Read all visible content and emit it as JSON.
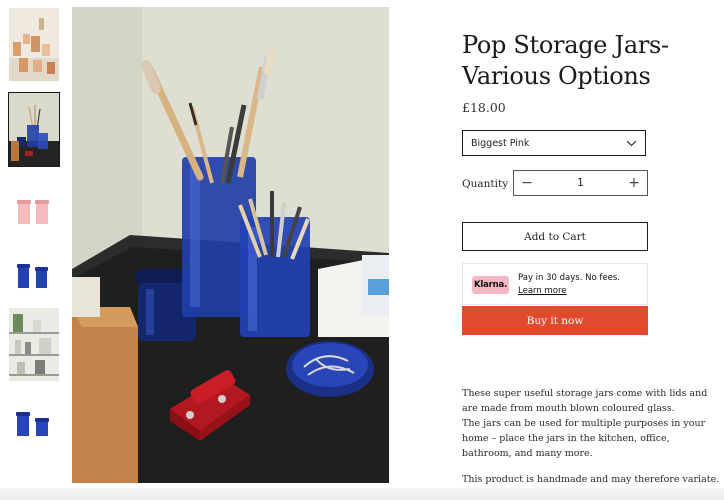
{
  "product": {
    "title_line1": "Pop Storage Jars-",
    "title_line2": "Various Options",
    "price": "£18.00"
  },
  "variant_select": {
    "selected": "Biggest Pink"
  },
  "quantity": {
    "label": "Quantity",
    "value": "1",
    "decrement": "−",
    "increment": "+"
  },
  "buttons": {
    "add_to_cart": "Add to Cart",
    "buy_now": "Buy it now"
  },
  "klarna": {
    "badge": "Klarna.",
    "message": "Pay in 30 days. No fees.",
    "link": "Learn more"
  },
  "description": {
    "p1": "These super useful storage jars come with lids and are made from mouth blown coloured glass.",
    "p2": "The jars can be used for multiple purposes in your home – place the jars in the kitchen, office, bathroom, and many more.",
    "p3": "This product is handmade and may therefore variate."
  },
  "thumbnails": [
    {
      "name": "thumbnail-amber-jars",
      "active": false
    },
    {
      "name": "thumbnail-blue-brush-jars",
      "active": true
    },
    {
      "name": "thumbnail-pink-jars",
      "active": false
    },
    {
      "name": "thumbnail-blue-jars",
      "active": false
    },
    {
      "name": "thumbnail-shelf",
      "active": false
    },
    {
      "name": "thumbnail-blue-jars-lids",
      "active": false
    }
  ],
  "colors": {
    "buy_now": "#e24a2d",
    "klarna_pink": "#f5b6c4",
    "jar_blue": "#1f3fa8"
  },
  "icons": {
    "select": "chevron-down-icon",
    "decrement": "minus-icon",
    "increment": "plus-icon"
  }
}
